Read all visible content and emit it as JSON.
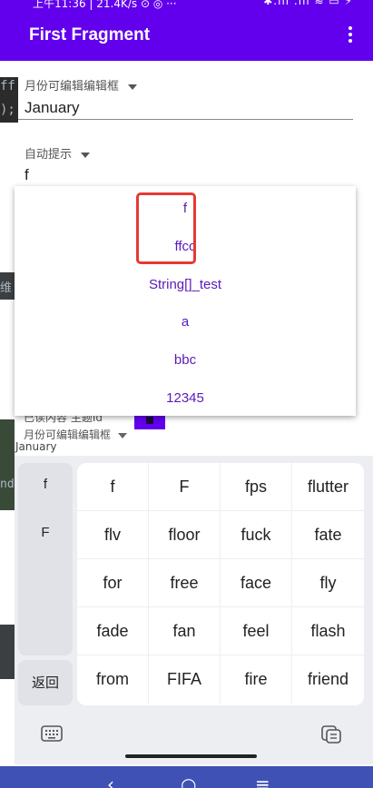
{
  "status_bar": {
    "text": "上午11:36 | 21.4K/s ⊙ ◎ ···",
    "icons": "✱.ııl .ııl ≋ ▭ ⚡"
  },
  "app_bar": {
    "title": "First Fragment"
  },
  "editor_bleed": {
    "line1": "ff",
    "line2": ");",
    "line3": "维",
    "line4": "nd"
  },
  "month_field": {
    "label": "月份可编辑编辑框",
    "value": "January"
  },
  "auto_field": {
    "label": "自动提示",
    "value": "f"
  },
  "suggestions": [
    "f",
    "ffcc",
    "String[]_test",
    "a",
    "bbc",
    "12345"
  ],
  "hidden_row": {
    "label": "已读内容",
    "label2": "主题Id"
  },
  "small_month": {
    "label": "月份可编辑编辑框",
    "value": "January"
  },
  "keyboard": {
    "left_keys": [
      "f",
      "F"
    ],
    "back_label": "返回",
    "rows": [
      [
        "f",
        "F",
        "fps",
        "flutter"
      ],
      [
        "flv",
        "floor",
        "fuck",
        "fate"
      ],
      [
        "for",
        "free",
        "face",
        "fly"
      ],
      [
        "fade",
        "fan",
        "feel",
        "flash"
      ],
      [
        "from",
        "FIFA",
        "fire",
        "friend"
      ]
    ]
  },
  "nav": {
    "back": "‹",
    "home": "○",
    "menu": "≡"
  }
}
